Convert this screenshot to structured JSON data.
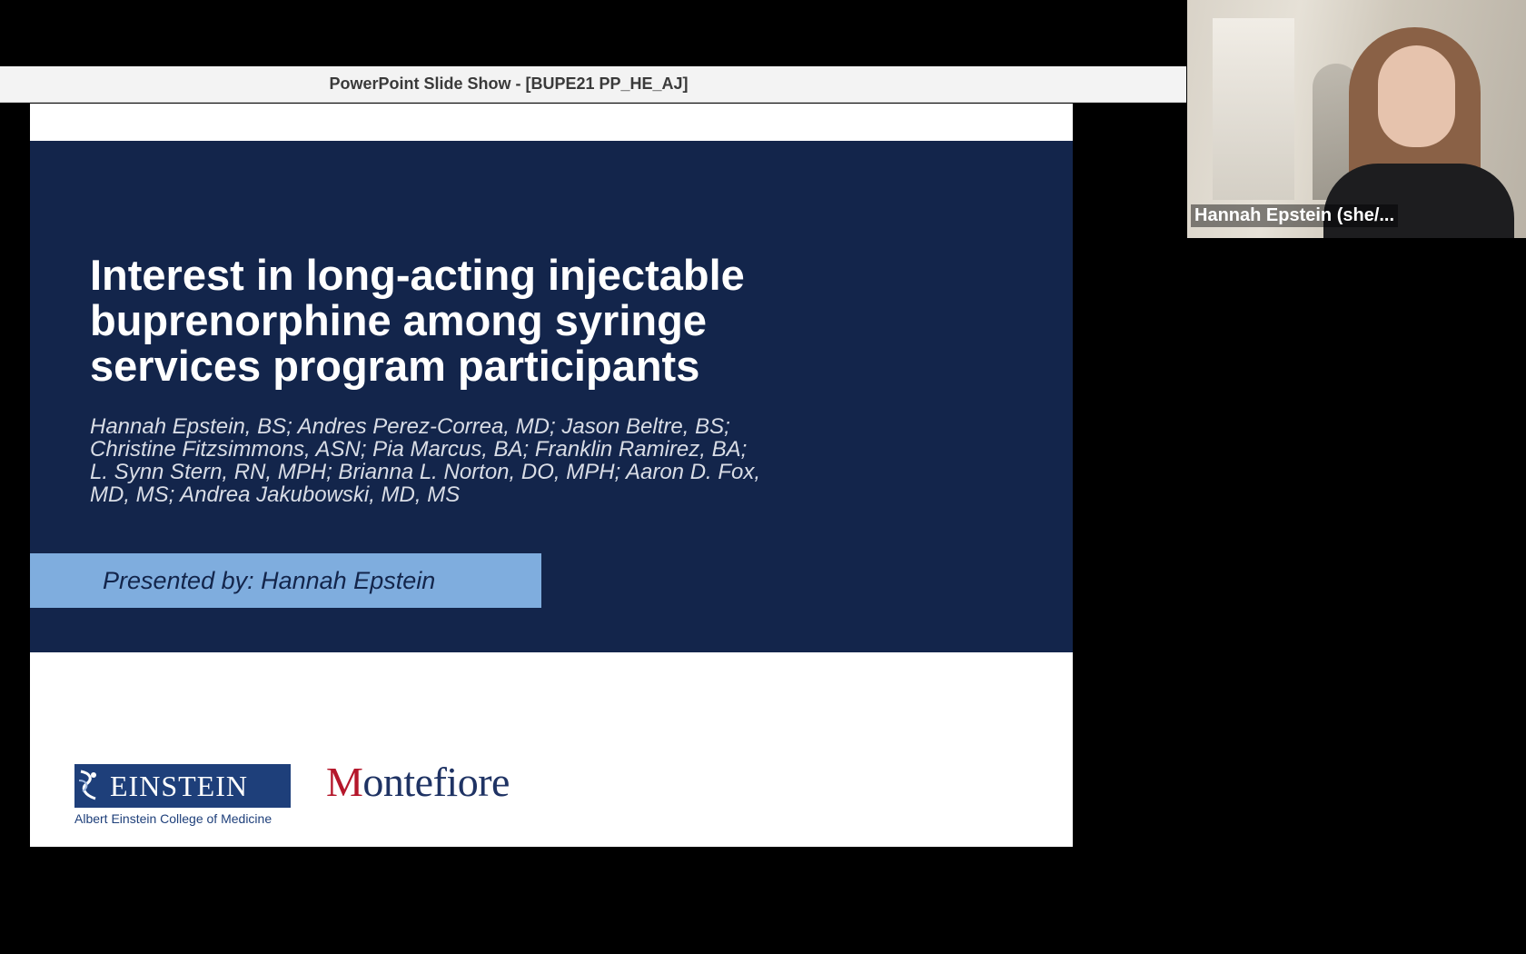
{
  "window": {
    "title": "PowerPoint Slide Show - [BUPE21 PP_HE_AJ]"
  },
  "slide": {
    "title_lines": [
      "Interest in long-acting injectable",
      "buprenorphine among syringe",
      "services program participants"
    ],
    "author_lines": [
      "Hannah Epstein, BS; Andres Perez-Correa, MD; Jason Beltre, BS;",
      "Christine Fitzsimmons, ASN; Pia Marcus, BA; Franklin Ramirez, BA;",
      "L. Synn Stern, RN, MPH; Brianna L. Norton, DO, MPH; Aaron D. Fox,",
      "MD, MS; Andrea Jakubowski, MD, MS"
    ],
    "presenter": "Presented by: Hannah Epstein",
    "logos": {
      "einstein_name": "EINSTEIN",
      "einstein_sub": "Albert Einstein College of Medicine",
      "montefiore_initial": "M",
      "montefiore_rest": "ontefiore"
    },
    "colors": {
      "band": "#13254b",
      "presenter_box": "#7fadde",
      "einstein_blue": "#1e3f7a",
      "montefiore_red": "#b5172b"
    }
  },
  "participant": {
    "name": "Hannah Epstein (she/..."
  }
}
